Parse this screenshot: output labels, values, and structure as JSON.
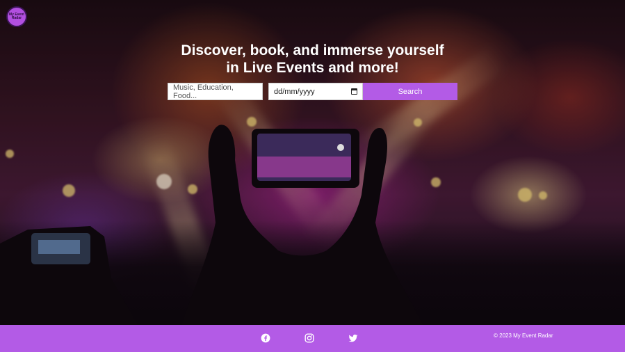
{
  "brand": {
    "logo_text": "My Event Radar"
  },
  "hero": {
    "headline": "Discover, book, and immerse yourself in Live Events and more!"
  },
  "search": {
    "keyword_placeholder": "Music, Education, Food...",
    "date_value": "dd/mm/yyyy",
    "button_label": "Search"
  },
  "footer": {
    "social": [
      "facebook-icon",
      "instagram-icon",
      "twitter-icon"
    ],
    "copyright": "© 2023 My Event Radar"
  },
  "colors": {
    "accent": "#b35be6",
    "logo": "#b24fe0",
    "text_light": "#ffffff"
  }
}
